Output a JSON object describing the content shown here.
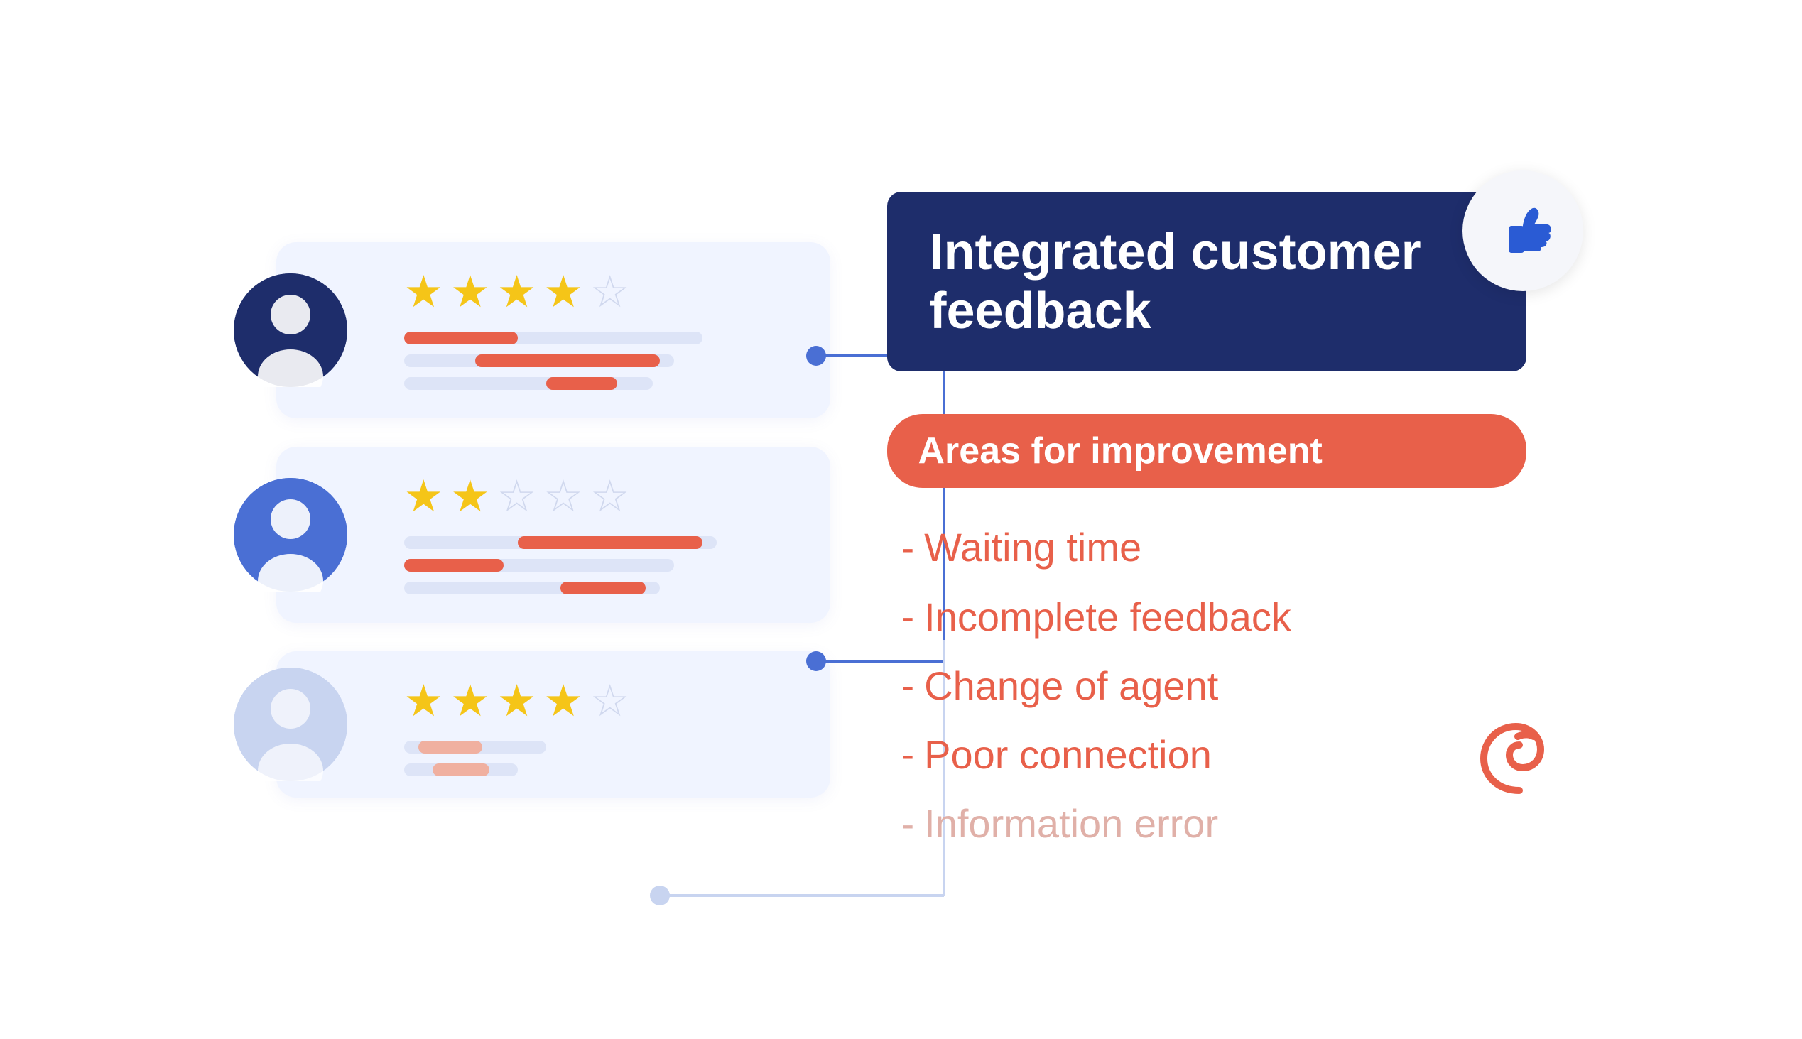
{
  "title": "Integrated customer feedback",
  "areas_badge": "Areas for improvement",
  "improvement_items": [
    {
      "id": "waiting-time",
      "label": "Waiting time",
      "opacity": "full"
    },
    {
      "id": "incomplete-feedback",
      "label": "Incomplete feedback",
      "opacity": "full"
    },
    {
      "id": "change-of-agent",
      "label": "Change of agent",
      "opacity": "full"
    },
    {
      "id": "poor-connection",
      "label": "Poor connection",
      "opacity": "full"
    },
    {
      "id": "information-error",
      "label": "Information error",
      "opacity": "faded"
    }
  ],
  "cards": [
    {
      "id": "card-1",
      "stars_filled": 4,
      "stars_empty": 1
    },
    {
      "id": "card-2",
      "stars_filled": 2,
      "stars_empty": 3
    },
    {
      "id": "card-3",
      "stars_filled": 4,
      "stars_empty": 1
    }
  ],
  "icons": {
    "thumbs_up": "👍",
    "swirl": "swirl"
  }
}
